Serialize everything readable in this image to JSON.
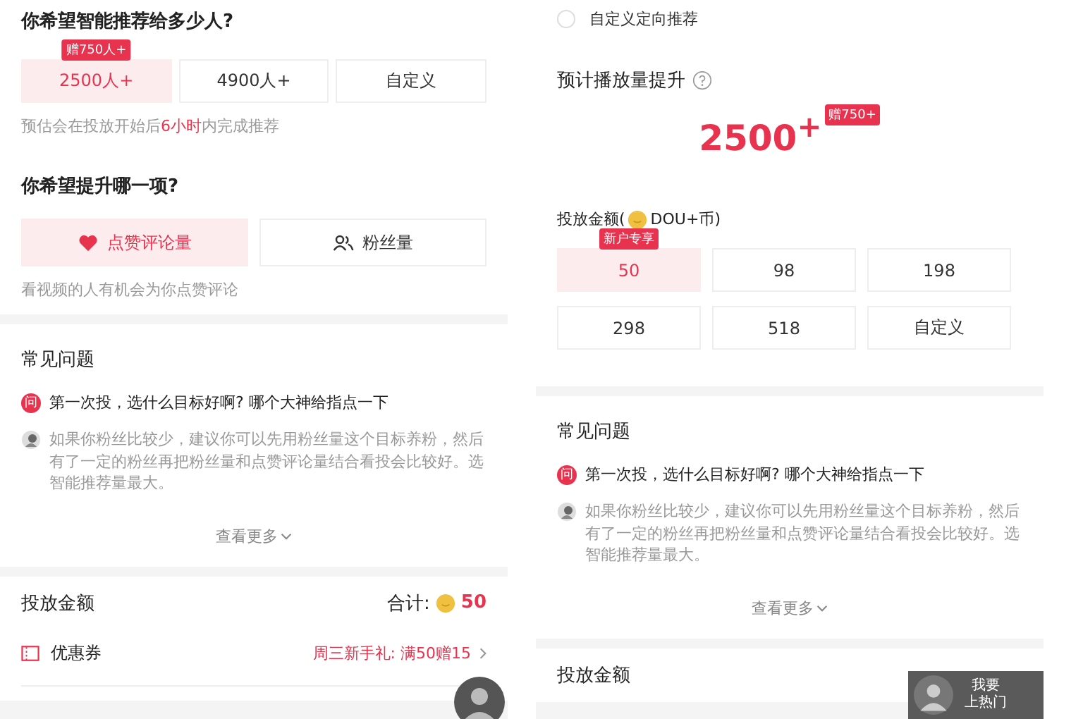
{
  "left": {
    "reach": {
      "title": "你希望智能推荐给多少人?",
      "options": [
        {
          "label": "2500人+",
          "selected": true,
          "badge": "赠750人+"
        },
        {
          "label": "4900人+",
          "selected": false
        },
        {
          "label": "自定义",
          "selected": false
        }
      ],
      "hint": {
        "before": "预估会在投放开始后",
        "highlight": "6小时",
        "after": "内完成推荐"
      }
    },
    "goal": {
      "title": "你希望提升哪一项?",
      "options": [
        {
          "label": "点赞评论量",
          "kind": "heart",
          "selected": true
        },
        {
          "label": "粉丝量",
          "kind": "people",
          "selected": false
        }
      ],
      "hint": "看视频的人有机会为你点赞评论"
    },
    "faq": {
      "title": "常见问题",
      "q_mark": "问",
      "question": "第一次投，选什么目标好啊? 哪个大神给指点一下",
      "answer": "如果你粉丝比较少，建议你可以先用粉丝量这个目标养粉，然后有了一定的粉丝再把粉丝量和点赞评论量结合看投会比较好。选智能推荐量最大。",
      "more": "查看更多"
    },
    "budget": {
      "title": "投放金额",
      "total_label": "合计:",
      "total": "50",
      "coupon_label": "优惠券",
      "coupon_value": "周三新手礼: 满50赠15"
    }
  },
  "right": {
    "radio": {
      "label": "自定义定向推荐",
      "selected": false
    },
    "estimate": {
      "title": "预计播放量提升",
      "value": "2500$^{+}$",
      "badge": "赠750+"
    },
    "amount": {
      "label_before": "投放金额(",
      "label_after": "DOU+币)",
      "options": [
        {
          "label": "50",
          "selected": true,
          "badge": "新户专享"
        },
        {
          "label": "98",
          "selected": false
        },
        {
          "label": "198",
          "selected": false
        },
        {
          "label": "298",
          "selected": false
        },
        {
          "label": "518",
          "selected": false
        },
        {
          "label": "自定义",
          "selected": false
        }
      ]
    },
    "faq": {
      "title": "常见问题",
      "q_mark": "问",
      "question": "第一次投，选什么目标好啊? 哪个大神给指点一下",
      "answer": "如果你粉丝比较少，建议你可以先用粉丝量这个目标养粉，然后有了一定的粉丝再把粉丝量和点赞评论量结合看投会比较好。选智能推荐量最大。",
      "more": "查看更多"
    },
    "budget": {
      "title": "投放金额"
    },
    "float_button": {
      "lines": [
        "我要",
        "上热门"
      ]
    }
  }
}
